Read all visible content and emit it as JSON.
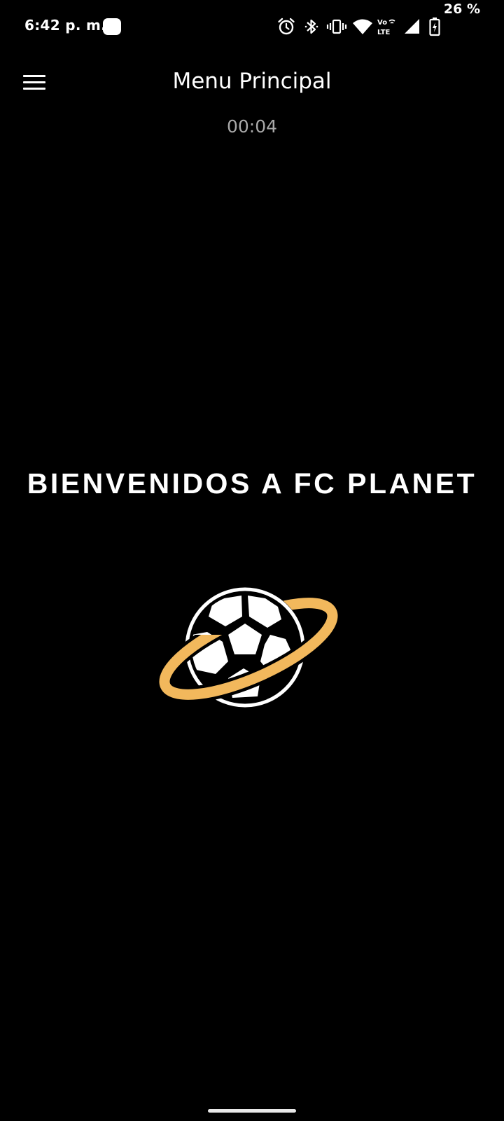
{
  "status_bar": {
    "time": "6:42 p. m.",
    "battery": "26 %",
    "icons": [
      "alarm-icon",
      "bluetooth-icon",
      "vibrate-icon",
      "wifi-icon",
      "volte-icon",
      "signal-icon",
      "battery-charging-icon"
    ],
    "volte_top": "Vo",
    "volte_bottom": "LTE"
  },
  "app_bar": {
    "menu_icon": "hamburger-icon",
    "title": "Menu Principal"
  },
  "timer": "00:04",
  "main": {
    "welcome_text": "BIENVENIDOS A FC PLANET",
    "logo_icon": "soccer-ball-planet-logo"
  },
  "colors": {
    "background": "#000000",
    "text": "#ffffff",
    "timer": "#a8a8a8",
    "ring": "#f2b85c"
  }
}
